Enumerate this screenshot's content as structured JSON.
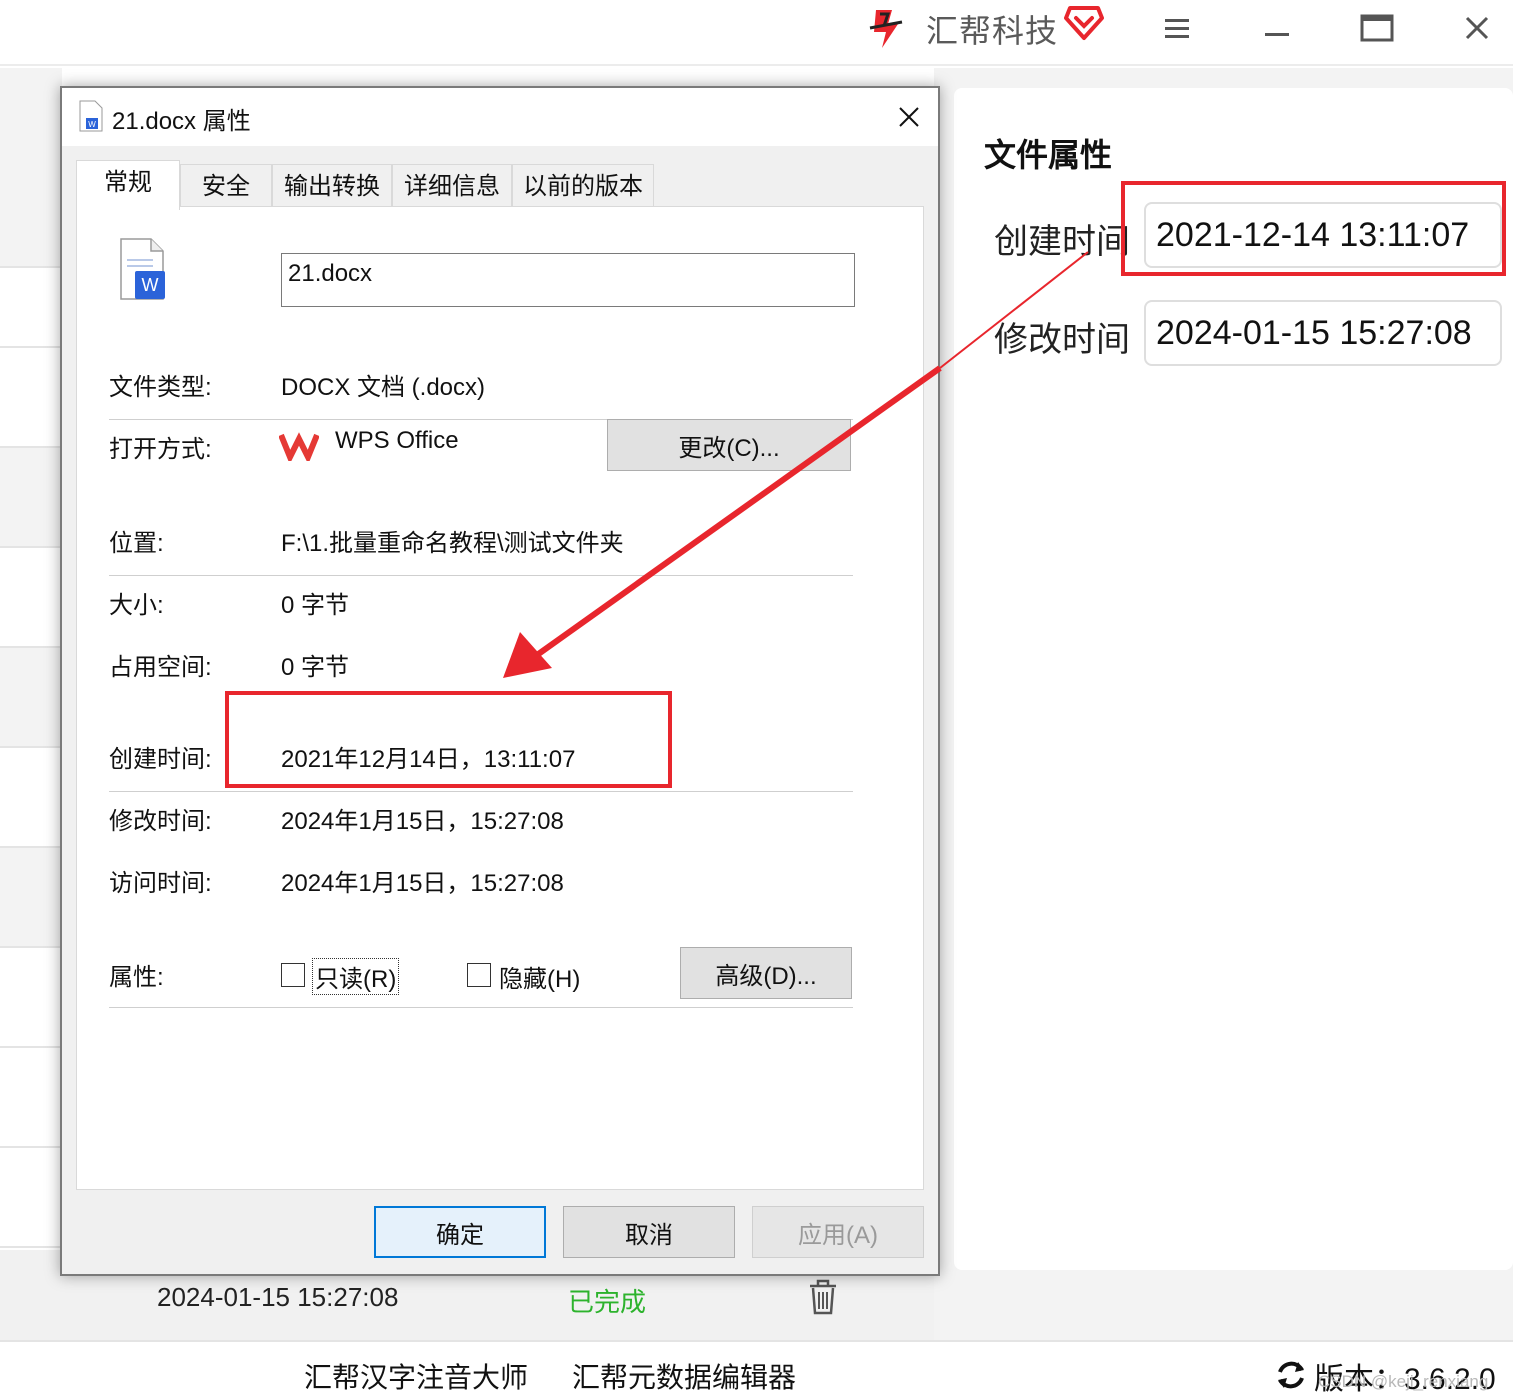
{
  "app": {
    "brand_name": "汇帮科技"
  },
  "list": {
    "last_row_date": "2024-01-15 15:27:08",
    "last_row_status": "已完成"
  },
  "panel": {
    "title": "文件属性",
    "created_label": "创建时间",
    "created_value": "2021-12-14 13:11:07",
    "modified_label": "修改时间",
    "modified_value": "2024-01-15 15:27:08"
  },
  "footer": {
    "link1": "汇帮汉字注音大师",
    "link2": "汇帮元数据编辑器",
    "version": "版本：3.6.2.0",
    "watermark": "CSDN @keji_renxiang"
  },
  "dialog": {
    "title": "21.docx 属性",
    "tabs": [
      "常规",
      "安全",
      "输出转换",
      "详细信息",
      "以前的版本"
    ],
    "filename": "21.docx",
    "type_label": "文件类型:",
    "type_value": "DOCX 文档 (.docx)",
    "open_label": "打开方式:",
    "open_app": "WPS Office",
    "change_button": "更改(C)...",
    "location_label": "位置:",
    "location_value": "F:\\1.批量重命名教程\\测试文件夹",
    "size_label": "大小:",
    "size_value": "0 字节",
    "disk_label": "占用空间:",
    "disk_value": "0 字节",
    "created_label": "创建时间:",
    "created_value": "2021年12月14日，13:11:07",
    "modified_label": "修改时间:",
    "modified_value": "2024年1月15日，15:27:08",
    "accessed_label": "访问时间:",
    "accessed_value": "2024年1月15日，15:27:08",
    "attr_label": "属性:",
    "readonly_label": "只读(R)",
    "hidden_label": "隐藏(H)",
    "advanced_button": "高级(D)...",
    "ok_button": "确定",
    "cancel_button": "取消",
    "apply_button": "应用(A)"
  },
  "colors": {
    "annotation": "#e8262d",
    "status_done": "#2db32d",
    "wps_red": "#e53935",
    "word_blue": "#2b63d9"
  }
}
